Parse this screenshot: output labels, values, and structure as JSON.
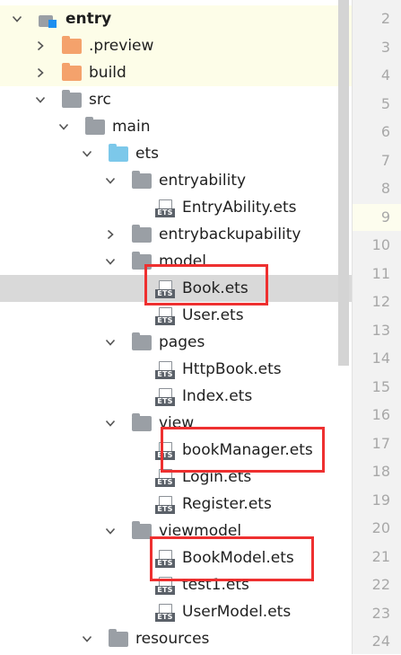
{
  "tree": {
    "items": [
      {
        "label": "entry",
        "icon": "module-icon",
        "chevron": "chevron-down-icon",
        "bold": true
      },
      {
        "label": ".preview",
        "icon": "folder-orange-icon",
        "chevron": "chevron-right-icon"
      },
      {
        "label": "build",
        "icon": "folder-orange-icon",
        "chevron": "chevron-right-icon"
      },
      {
        "label": "src",
        "icon": "folder-gray-icon",
        "chevron": "chevron-down-icon"
      },
      {
        "label": "main",
        "icon": "folder-gray-icon",
        "chevron": "chevron-down-icon"
      },
      {
        "label": "ets",
        "icon": "folder-blue-icon",
        "chevron": "chevron-down-icon"
      },
      {
        "label": "entryability",
        "icon": "folder-gray-icon",
        "chevron": "chevron-down-icon"
      },
      {
        "label": "EntryAbility.ets",
        "icon": "ets-file-icon",
        "chevron": ""
      },
      {
        "label": "entrybackupability",
        "icon": "folder-gray-icon",
        "chevron": "chevron-right-icon"
      },
      {
        "label": "model",
        "icon": "folder-gray-icon",
        "chevron": "chevron-down-icon"
      },
      {
        "label": "Book.ets",
        "icon": "ets-file-icon",
        "chevron": ""
      },
      {
        "label": "User.ets",
        "icon": "ets-file-icon",
        "chevron": ""
      },
      {
        "label": "pages",
        "icon": "folder-gray-icon",
        "chevron": "chevron-down-icon"
      },
      {
        "label": "HttpBook.ets",
        "icon": "ets-file-icon",
        "chevron": ""
      },
      {
        "label": "Index.ets",
        "icon": "ets-file-icon",
        "chevron": ""
      },
      {
        "label": "view",
        "icon": "folder-gray-icon",
        "chevron": "chevron-down-icon"
      },
      {
        "label": "bookManager.ets",
        "icon": "ets-file-icon",
        "chevron": ""
      },
      {
        "label": "Login.ets",
        "icon": "ets-file-icon",
        "chevron": ""
      },
      {
        "label": "Register.ets",
        "icon": "ets-file-icon",
        "chevron": ""
      },
      {
        "label": "viewmodel",
        "icon": "folder-gray-icon",
        "chevron": "chevron-down-icon"
      },
      {
        "label": "BookModel.ets",
        "icon": "ets-file-icon",
        "chevron": ""
      },
      {
        "label": "test1.ets",
        "icon": "ets-file-icon",
        "chevron": ""
      },
      {
        "label": "UserModel.ets",
        "icon": "ets-file-icon",
        "chevron": ""
      },
      {
        "label": "resources",
        "icon": "folder-gray-icon",
        "chevron": "chevron-down-icon"
      }
    ],
    "ets_badge": "ETS"
  },
  "gutter": {
    "line_numbers": [
      "2",
      "3",
      "4",
      "5",
      "6",
      "7",
      "8",
      "9",
      "10",
      "11",
      "12",
      "13",
      "14",
      "15",
      "16",
      "17",
      "18",
      "19",
      "20",
      "21",
      "22",
      "23",
      "24"
    ]
  },
  "colors": {
    "highlight_box": "#ee3030",
    "selected_row": "#d9d9d9",
    "excluded_row": "#fdfde8",
    "folder_gray": "#9a9fa5",
    "folder_orange": "#f4a26c",
    "folder_blue": "#7cc8ea",
    "module_accent": "#1d8ff0"
  }
}
